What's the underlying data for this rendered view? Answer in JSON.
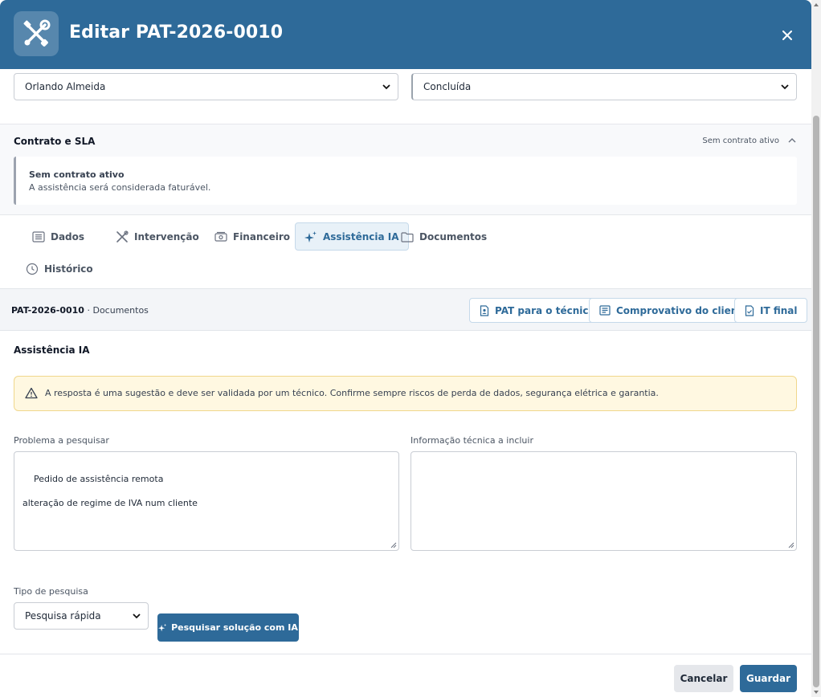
{
  "header": {
    "title": "Editar PAT-2026-0010",
    "icon": "tools-icon",
    "close_icon": "close-icon"
  },
  "selects": {
    "technician": "Orlando Almeida",
    "status": "Concluída"
  },
  "contract": {
    "title": "Contrato e SLA",
    "status": "Sem contrato ativo",
    "card_title": "Sem contrato ativo",
    "card_text": "A assistência será considerada faturável."
  },
  "tabs": [
    {
      "label": "Dados",
      "icon": "list-icon"
    },
    {
      "label": "Intervenção",
      "icon": "tools-icon"
    },
    {
      "label": "Financeiro",
      "icon": "money-icon"
    },
    {
      "label": "Assistência IA",
      "icon": "sparkles-icon",
      "active": true
    },
    {
      "label": "Documentos",
      "icon": "folder-icon"
    },
    {
      "label": "Histórico",
      "icon": "clock-icon"
    }
  ],
  "docbar": {
    "code": "PAT-2026-0010",
    "separator": " · ",
    "section": "Documentos",
    "buttons": [
      {
        "label": "PAT para o técnico",
        "icon": "user-document-icon"
      },
      {
        "label": "Comprovativo do cliente",
        "icon": "receipt-icon"
      },
      {
        "label": "IT final",
        "icon": "check-document-icon"
      }
    ]
  },
  "ai": {
    "title": "Assistência IA",
    "warning": "A resposta é uma sugestão e deve ser validada por um técnico. Confirme sempre riscos de perda de dados, segurança elétrica e garantia.",
    "problem_label": "Problema a pesquisar",
    "problem_value": "Pedido de assistência remota\n\nalteração de regime de IVA num cliente",
    "info_label": "Informação técnica a incluir",
    "info_value": "",
    "search_type_label": "Tipo de pesquisa",
    "search_type_value": "Pesquisa rápida",
    "search_button": "Pesquisar solução com IA"
  },
  "footer": {
    "cancel": "Cancelar",
    "save": "Guardar"
  },
  "colors": {
    "primary": "#2e6a99",
    "warning_bg": "#fff8e1",
    "active_tab_bg": "#e8f1f8"
  }
}
